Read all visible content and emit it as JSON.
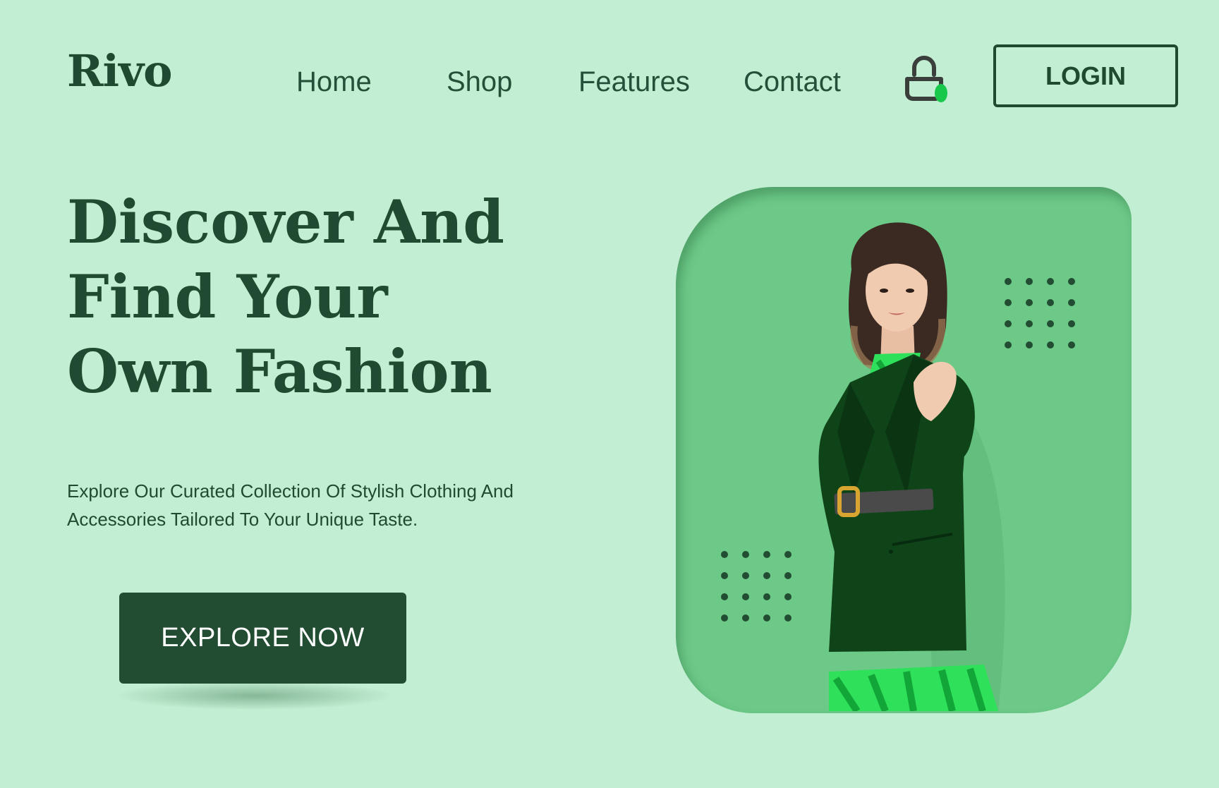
{
  "brand": {
    "logo_text": "Rivo"
  },
  "nav": {
    "items": [
      {
        "label": "Home"
      },
      {
        "label": "Shop"
      },
      {
        "label": "Features"
      },
      {
        "label": "Contact"
      }
    ],
    "cart_icon": "shopping-bag-icon",
    "login_label": "LOGIN"
  },
  "hero": {
    "title_lines": [
      "Discover And",
      "Find Your",
      "Own Fashion"
    ],
    "subtitle_lines": [
      "Explore Our Curated Collection Of Stylish Clothing And",
      "Accessories Tailored To Your Unique Taste."
    ],
    "cta_label": "EXPLORE NOW"
  },
  "colors": {
    "page_background": "#c2eed3",
    "primary_dark": "#234d33",
    "card_green": "#6cc987",
    "cart_badge": "#18c84b",
    "accent_bright_green": "#2ee05a"
  }
}
